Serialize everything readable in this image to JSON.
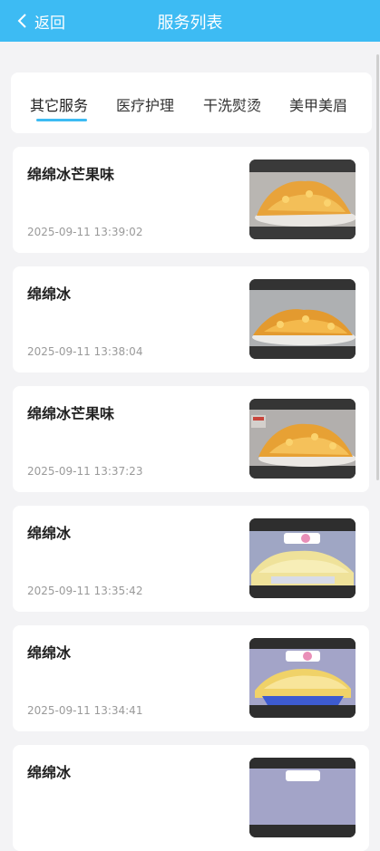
{
  "header": {
    "back_label": "返回",
    "title": "服务列表"
  },
  "tabs": [
    {
      "label": "其它服务",
      "active": true
    },
    {
      "label": "医疗护理",
      "active": false
    },
    {
      "label": "干洗熨烫",
      "active": false
    },
    {
      "label": "美甲美眉",
      "active": false
    }
  ],
  "services": [
    {
      "name": "绵绵冰芒果味",
      "time": "2025-09-11 13:39:02",
      "image": "mango-shaved-ice-icon"
    },
    {
      "name": "绵绵冰",
      "time": "2025-09-11 13:38:04",
      "image": "mango-shaved-ice-icon"
    },
    {
      "name": "绵绵冰芒果味",
      "time": "2025-09-11 13:37:23",
      "image": "mango-shaved-ice-icon"
    },
    {
      "name": "绵绵冰",
      "time": "2025-09-11 13:35:42",
      "image": "shaved-ice-cup-icon"
    },
    {
      "name": "绵绵冰",
      "time": "2025-09-11 13:34:41",
      "image": "shaved-ice-cup-icon"
    },
    {
      "name": "绵绵冰",
      "time": "",
      "image": "shaved-ice-cup-icon"
    }
  ],
  "colors": {
    "header": "#3dbbf3",
    "accent": "#3dbbf3",
    "background": "#f3f3f5"
  }
}
